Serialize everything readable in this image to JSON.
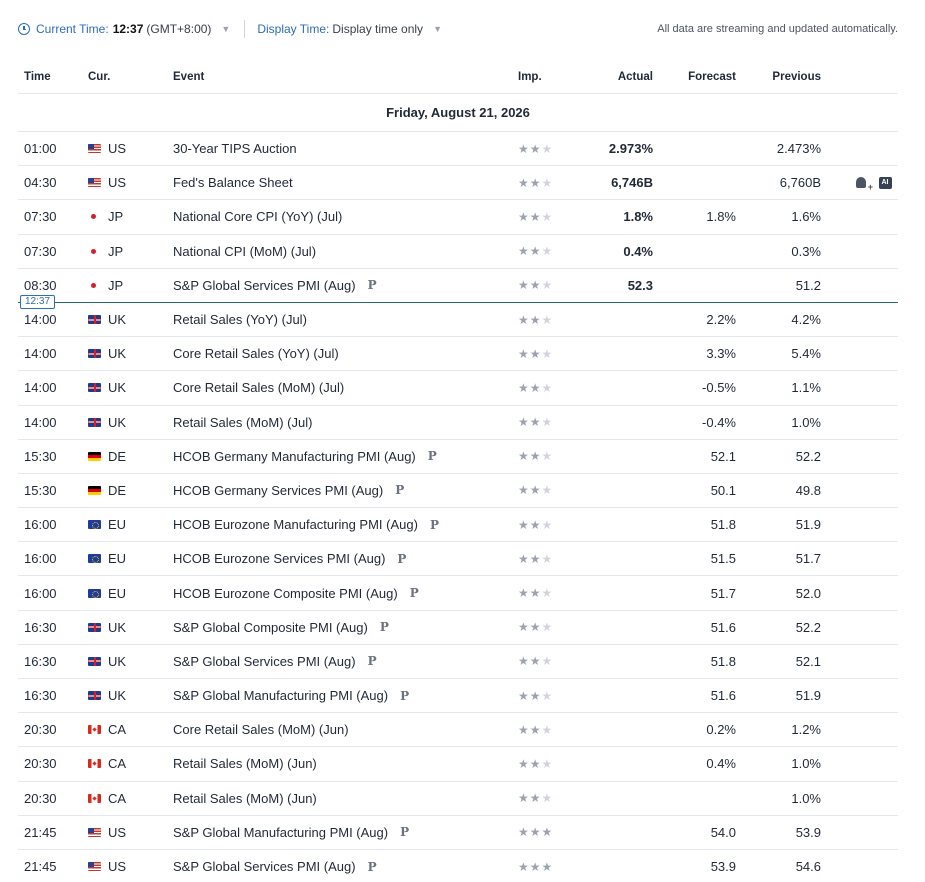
{
  "header": {
    "current_time_label": "Current Time:",
    "current_time_value": "12:37",
    "timezone": "(GMT+8:00)",
    "display_time_label": "Display Time:",
    "display_time_value": "Display time only",
    "status_text": "All data are streaming and updated automatically.",
    "caret": "▼"
  },
  "columns": {
    "time": "Time",
    "cur": "Cur.",
    "event": "Event",
    "imp": "Imp.",
    "actual": "Actual",
    "forecast": "Forecast",
    "previous": "Previous"
  },
  "date_label": "Friday, August 21, 2026",
  "now_marker": "12:37",
  "colors": {
    "accent": "#2f6db5",
    "now_line": "#2b6a6a"
  },
  "rows": [
    {
      "time": "01:00",
      "flag": "us",
      "cur": "US",
      "event": "30-Year TIPS Auction",
      "prelim": "",
      "stars": 2,
      "actual": "2.973%",
      "forecast": "",
      "previous": "2.473%"
    },
    {
      "time": "04:30",
      "flag": "us",
      "cur": "US",
      "event": "Fed's Balance Sheet",
      "prelim": "",
      "stars": 2,
      "actual": "6,746B",
      "forecast": "",
      "previous": "6,760B",
      "tools": true
    },
    {
      "time": "07:30",
      "flag": "jp",
      "cur": "JP",
      "event": "National Core CPI (YoY) (Jul)",
      "prelim": "",
      "stars": 2,
      "actual": "1.8%",
      "forecast": "1.8%",
      "previous": "1.6%"
    },
    {
      "time": "07:30",
      "flag": "jp",
      "cur": "JP",
      "event": "National CPI (MoM) (Jul)",
      "prelim": "",
      "stars": 2,
      "actual": "0.4%",
      "forecast": "",
      "previous": "0.3%"
    },
    {
      "time": "08:30",
      "flag": "jp",
      "cur": "JP",
      "event": "S&P Global Services PMI (Aug)",
      "prelim": "P",
      "stars": 2,
      "actual": "52.3",
      "forecast": "",
      "previous": "51.2"
    },
    {
      "time": "14:00",
      "flag": "uk",
      "cur": "UK",
      "event": "Retail Sales (YoY) (Jul)",
      "prelim": "",
      "stars": 2,
      "actual": "",
      "forecast": "2.2%",
      "previous": "4.2%"
    },
    {
      "time": "14:00",
      "flag": "uk",
      "cur": "UK",
      "event": "Core Retail Sales (YoY) (Jul)",
      "prelim": "",
      "stars": 2,
      "actual": "",
      "forecast": "3.3%",
      "previous": "5.4%"
    },
    {
      "time": "14:00",
      "flag": "uk",
      "cur": "UK",
      "event": "Core Retail Sales (MoM) (Jul)",
      "prelim": "",
      "stars": 2,
      "actual": "",
      "forecast": "-0.5%",
      "previous": "1.1%"
    },
    {
      "time": "14:00",
      "flag": "uk",
      "cur": "UK",
      "event": "Retail Sales (MoM) (Jul)",
      "prelim": "",
      "stars": 2,
      "actual": "",
      "forecast": "-0.4%",
      "previous": "1.0%"
    },
    {
      "time": "15:30",
      "flag": "de",
      "cur": "DE",
      "event": "HCOB Germany Manufacturing PMI (Aug)",
      "prelim": "P",
      "stars": 2,
      "actual": "",
      "forecast": "52.1",
      "previous": "52.2"
    },
    {
      "time": "15:30",
      "flag": "de",
      "cur": "DE",
      "event": "HCOB Germany Services PMI (Aug)",
      "prelim": "P",
      "stars": 2,
      "actual": "",
      "forecast": "50.1",
      "previous": "49.8"
    },
    {
      "time": "16:00",
      "flag": "eu",
      "cur": "EU",
      "event": "HCOB Eurozone Manufacturing PMI (Aug)",
      "prelim": "P",
      "stars": 2,
      "actual": "",
      "forecast": "51.8",
      "previous": "51.9"
    },
    {
      "time": "16:00",
      "flag": "eu",
      "cur": "EU",
      "event": "HCOB Eurozone Services PMI (Aug)",
      "prelim": "P",
      "stars": 2,
      "actual": "",
      "forecast": "51.5",
      "previous": "51.7"
    },
    {
      "time": "16:00",
      "flag": "eu",
      "cur": "EU",
      "event": "HCOB Eurozone Composite PMI (Aug)",
      "prelim": "P",
      "stars": 2,
      "actual": "",
      "forecast": "51.7",
      "previous": "52.0"
    },
    {
      "time": "16:30",
      "flag": "uk",
      "cur": "UK",
      "event": "S&P Global Composite PMI (Aug)",
      "prelim": "P",
      "stars": 2,
      "actual": "",
      "forecast": "51.6",
      "previous": "52.2"
    },
    {
      "time": "16:30",
      "flag": "uk",
      "cur": "UK",
      "event": "S&P Global Services PMI (Aug)",
      "prelim": "P",
      "stars": 2,
      "actual": "",
      "forecast": "51.8",
      "previous": "52.1"
    },
    {
      "time": "16:30",
      "flag": "uk",
      "cur": "UK",
      "event": "S&P Global Manufacturing PMI (Aug)",
      "prelim": "P",
      "stars": 2,
      "actual": "",
      "forecast": "51.6",
      "previous": "51.9"
    },
    {
      "time": "20:30",
      "flag": "ca",
      "cur": "CA",
      "event": "Core Retail Sales (MoM) (Jun)",
      "prelim": "",
      "stars": 2,
      "actual": "",
      "forecast": "0.2%",
      "previous": "1.2%"
    },
    {
      "time": "20:30",
      "flag": "ca",
      "cur": "CA",
      "event": "Retail Sales (MoM) (Jun)",
      "prelim": "",
      "stars": 2,
      "actual": "",
      "forecast": "0.4%",
      "previous": "1.0%"
    },
    {
      "time": "20:30",
      "flag": "ca",
      "cur": "CA",
      "event": "Retail Sales (MoM) (Jun)",
      "prelim": "",
      "stars": 2,
      "actual": "",
      "forecast": "",
      "previous": "1.0%"
    },
    {
      "time": "21:45",
      "flag": "us",
      "cur": "US",
      "event": "S&P Global Manufacturing PMI (Aug)",
      "prelim": "P",
      "stars": 3,
      "actual": "",
      "forecast": "54.0",
      "previous": "53.9"
    },
    {
      "time": "21:45",
      "flag": "us",
      "cur": "US",
      "event": "S&P Global Services PMI (Aug)",
      "prelim": "P",
      "stars": 3,
      "actual": "",
      "forecast": "53.9",
      "previous": "54.6"
    }
  ]
}
